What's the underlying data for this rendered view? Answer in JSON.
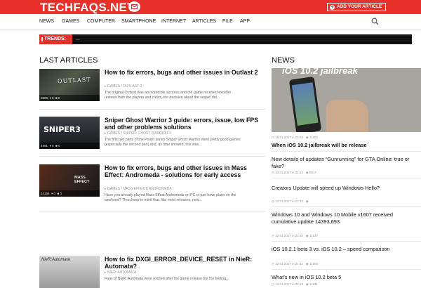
{
  "header": {
    "logo": "TECHFAQS.NET",
    "add_article_label": "ADD YOUR ARTICLE",
    "brand_color": "#e8302a"
  },
  "nav": {
    "items": [
      "NEWS",
      "GAMES",
      "COMPUTER",
      "SMARTPHONE",
      "INTERNET",
      "ARTICLES",
      "FILE",
      "APP"
    ]
  },
  "trends": {
    "label": "TRENDS:",
    "text": "..."
  },
  "sections": {
    "last_articles": "LAST ARTICLES",
    "news": "NEWS"
  },
  "articles": [
    {
      "title": "How to fix errors, bugs and other issues in Outlast 2",
      "thumb_text": "OUTLAST",
      "cat": "GAMES / OUTLAST 2",
      "views": "6509",
      "likes": "0",
      "comments": "0",
      "excerpt": [
        "The original Outlast was an incredible success and the game received exceller",
        "reviews from the players and critics, the decision about the sequel did..."
      ]
    },
    {
      "title": "Sniper Ghost Warrior 3 guide: errors, issue, low FPS and other problems solutions",
      "thumb_text": "SNIPER3",
      "cat": "GAMES / SNIPER: GHOST WARRIOR 3",
      "views": "4981",
      "likes": "0",
      "comments": "0",
      "excerpt": [
        "The first two parts of the Polish series Sniper Ghost Warrior were pretty good games",
        "(especially the second part) and, as time showed, this was..."
      ]
    },
    {
      "title": "How to fix errors, bugs and other issues in Mass Effect: Andromeda - solutions for early access",
      "thumb_text": "MASS EFFECT",
      "cat": "GAMES / MASS EFFECT: ANDROMEDA",
      "views": "14156",
      "likes": "0",
      "comments": "0",
      "excerpt": [
        "Have you already played Mass Effect Andromeda on PC or just have plans on the",
        "weekend? Then keep in mind that, like most releases, new..."
      ]
    },
    {
      "title": "How to fix DXGI_ERROR_DEVICE_RESET in NieR: Automata?",
      "thumb_text": "NieR:Automata",
      "cat": "NIER: AUTOMATA",
      "views": "",
      "likes": "",
      "comments": "",
      "excerpt": [
        "Fans of NieR: Automata were excited after the game release but the feeling..."
      ]
    }
  ],
  "news": [
    {
      "date": "15.01.2017 in 22:53",
      "views": "11852",
      "title": "When iOS 10.2 jailbreak will be release",
      "bold": true
    },
    {
      "date": "12.01.2017 in 22:13",
      "views": "9947",
      "title": "New details of updates “Gunrunning” for GTA Online: true or fake?",
      "bold": false
    },
    {
      "date": "12.01.2017 in 22:32",
      "views": "",
      "title": "Creators Update will speed up Windows Hello?",
      "bold": false
    },
    {
      "date": "12.01.2017 in 22:40",
      "views": "11537",
      "title": "Windows 10 and Windows 10 Mobile v1607 received cumulative update 14393,693",
      "bold": false
    },
    {
      "date": "12.01.2017 in 22:12",
      "views": "11594",
      "title": "iOS 10.2.1 beta 3 vs. iOS 10.2 – speed comparison",
      "bold": false
    },
    {
      "date": "12.01.2017 in 22:29",
      "views": "11611",
      "title": "What’s new in iOS 10.2 beta 5",
      "bold": false
    }
  ],
  "news_image_text": "iOS 10.2 jailbreak"
}
